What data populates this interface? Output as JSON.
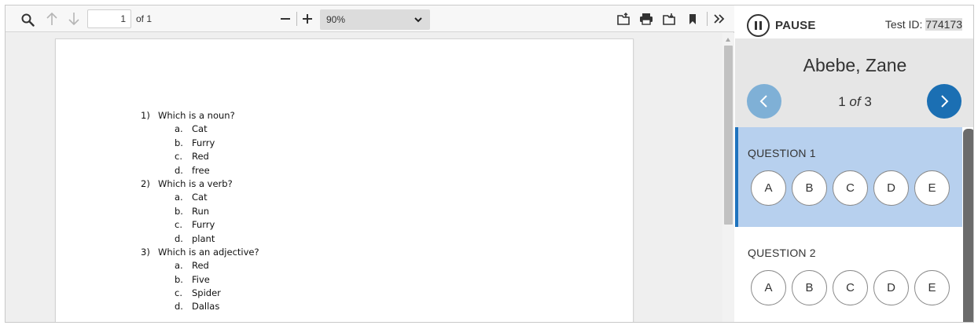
{
  "viewer": {
    "toolbar": {
      "page_current": "1",
      "page_total_label": "of 1",
      "zoom_value": "90%",
      "icons": [
        "search-icon",
        "arrow-up-icon",
        "arrow-down-icon",
        "minus-icon",
        "plus-icon",
        "chevron-down-icon",
        "open-file-icon",
        "print-icon",
        "download-icon",
        "bookmark-icon",
        "double-chevron-right-icon"
      ]
    },
    "document": {
      "questions": [
        {
          "number": "1)",
          "text": "Which is a noun?",
          "options": [
            {
              "letter": "a.",
              "text": "Cat"
            },
            {
              "letter": "b.",
              "text": "Furry"
            },
            {
              "letter": "c.",
              "text": "Red"
            },
            {
              "letter": "d.",
              "text": "free"
            }
          ]
        },
        {
          "number": "2)",
          "text": "Which is a verb?",
          "options": [
            {
              "letter": "a.",
              "text": "Cat"
            },
            {
              "letter": "b.",
              "text": "Run"
            },
            {
              "letter": "c.",
              "text": "Furry"
            },
            {
              "letter": "d.",
              "text": "plant"
            }
          ]
        },
        {
          "number": "3)",
          "text": "Which is an adjective?",
          "options": [
            {
              "letter": "a.",
              "text": "Red"
            },
            {
              "letter": "b.",
              "text": "Five"
            },
            {
              "letter": "c.",
              "text": "Spider"
            },
            {
              "letter": "d.",
              "text": "Dallas"
            }
          ]
        }
      ]
    }
  },
  "panel": {
    "pause_label": "PAUSE",
    "test_id_label": "Test ID:",
    "test_id_value": "774173",
    "student_name": "Abebe, Zane",
    "pager": {
      "current": "1",
      "of": "of",
      "total": "3"
    },
    "questions": [
      {
        "title": "QUESTION 1",
        "choices": [
          "A",
          "B",
          "C",
          "D",
          "E"
        ],
        "active": true
      },
      {
        "title": "QUESTION 2",
        "choices": [
          "A",
          "B",
          "C",
          "D",
          "E"
        ],
        "active": false
      }
    ],
    "colors": {
      "accent": "#1e73be",
      "active_card": "#b7d0ee",
      "next_button": "#1b6fb3",
      "prev_button": "#7fb0d6"
    }
  }
}
